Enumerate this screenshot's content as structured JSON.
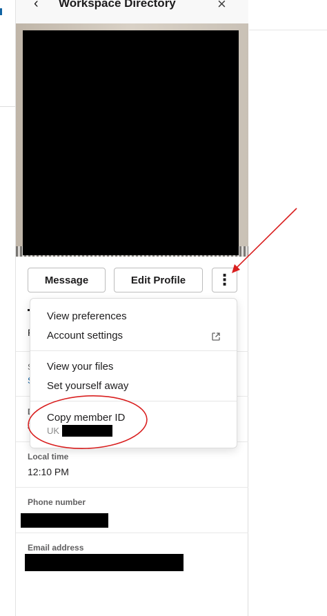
{
  "panel": {
    "title": "Workspace Directory",
    "back_icon": "‹",
    "close_icon": "×"
  },
  "actions": {
    "message": "Message",
    "edit_profile": "Edit Profile",
    "more": "⋮"
  },
  "menu": {
    "items": [
      {
        "label": "View preferences"
      },
      {
        "label": "Account settings"
      },
      {
        "label": "View your files"
      },
      {
        "label": "Set yourself away"
      },
      {
        "label": "Copy member ID"
      }
    ],
    "member_id_prefix": "UK"
  },
  "profile": {
    "title_stub": "F",
    "status_stub": "S",
    "status_link_stub": "S",
    "display_stub": "D",
    "display_value_stub": "J",
    "local_time_label": "Local time",
    "local_time_value": "12:10 PM",
    "phone_label": "Phone number",
    "email_label": "Email address"
  },
  "colors": {
    "annotation": "#d91f1f",
    "link": "#1264a3"
  }
}
